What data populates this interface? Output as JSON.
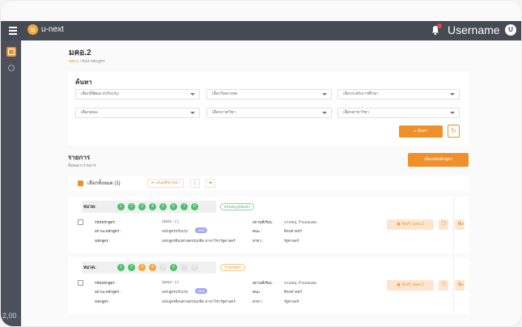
{
  "app": {
    "logo_letter": "u",
    "logo_text": "u-next",
    "username": "Username",
    "avatar_letter": "U"
  },
  "page": {
    "title": "มคอ.2",
    "breadcrumb": [
      "มคอ.2",
      "/",
      "ค้นหาหลักสูตร"
    ]
  },
  "search": {
    "title": "ค้นหา",
    "filters": [
      "เลือกปีพัฒนา/ปรับปรุง",
      "เลือกวิทยาเขต",
      "เลือกระดับการศึกษา",
      "เลือกคณะ",
      "เลือกภาควิชา",
      "เลือกสาขาวิชา"
    ],
    "search_label": "ค้นหา",
    "reset_icon": "refresh-icon"
  },
  "list": {
    "title": "รายการ",
    "count": "ทั้งหมด 0 รายการ",
    "add_label": "เพิ่มเล่มหลักสูตร",
    "select_all_label": "เลือกทั้งหมด (1)",
    "propose_label": "เสนอพิจารณา"
  },
  "cards": [
    {
      "sem_label": "หมวด:",
      "sems": [
        {
          "n": "1",
          "state": "green"
        },
        {
          "n": "2",
          "state": "green"
        },
        {
          "n": "3",
          "state": "green"
        },
        {
          "n": "4",
          "state": "green"
        },
        {
          "n": "5",
          "state": "green"
        },
        {
          "n": "6",
          "state": "green"
        },
        {
          "n": "7",
          "state": "green"
        },
        {
          "n": "8",
          "state": "green"
        }
      ],
      "status": "ครบสมบูรณ์แล้ว",
      "status_color": "green",
      "fields": {
        "code_label": "รหัสหลักสูตร :",
        "code_value": "11012 - (-)",
        "state_label": "สถานะหลักสูตร :",
        "state_value": "หลักสูตรปรับปรุง",
        "year": "2565",
        "course_label": "หลักสูตร :",
        "course_value": "หลักสูตรศิลปศาสตรบัณฑิต สาขาวิชารัฐศาสตร์",
        "place_label": "สถานที่เรียน :",
        "place_value": "บางเขน, กำแพงแสน",
        "faculty_label": "คณะ :",
        "faculty_value": "ศิลปศาสตร์",
        "branch_label": "สาขา :",
        "branch_value": "รัฐศาสตร์"
      },
      "send_label": "จัดทำ มคอ.2"
    },
    {
      "sem_label": "หมวด:",
      "sems": [
        {
          "n": "1",
          "state": "green"
        },
        {
          "n": "2",
          "state": "green"
        },
        {
          "n": "3",
          "state": "orange"
        },
        {
          "n": "4",
          "state": "orange"
        },
        {
          "n": "5",
          "state": "gray"
        },
        {
          "n": "6",
          "state": "green"
        },
        {
          "n": "7",
          "state": "gray"
        },
        {
          "n": "8",
          "state": "gray"
        }
      ],
      "status": "กำลังจัดทำ",
      "status_color": "orange",
      "fields": {
        "code_label": "รหัสหลักสูตร :",
        "code_value": "11012 - (-)",
        "state_label": "สถานะหลักสูตร :",
        "state_value": "หลักสูตรปรับปรุง",
        "year": "2565",
        "course_label": "หลักสูตร :",
        "course_value": "หลักสูตรศิลปศาสตรบัณฑิต สาขาวิชารัฐศาสตร์",
        "place_label": "สถานที่เรียน :",
        "place_value": "บางเขน, กำแพงแสน",
        "faculty_label": "คณะ :",
        "faculty_value": "ศิลปศาสตร์",
        "branch_label": "สาขา :",
        "branch_value": "รัฐศาสตร์"
      },
      "send_label": "จัดทำ มคอ.2"
    }
  ],
  "sidebar": {
    "corner_text": "2,00"
  },
  "colors": {
    "accent": "#f0902b",
    "topbar": "#454a54",
    "green": "#49c06a",
    "pill": "#a3a7f0"
  }
}
